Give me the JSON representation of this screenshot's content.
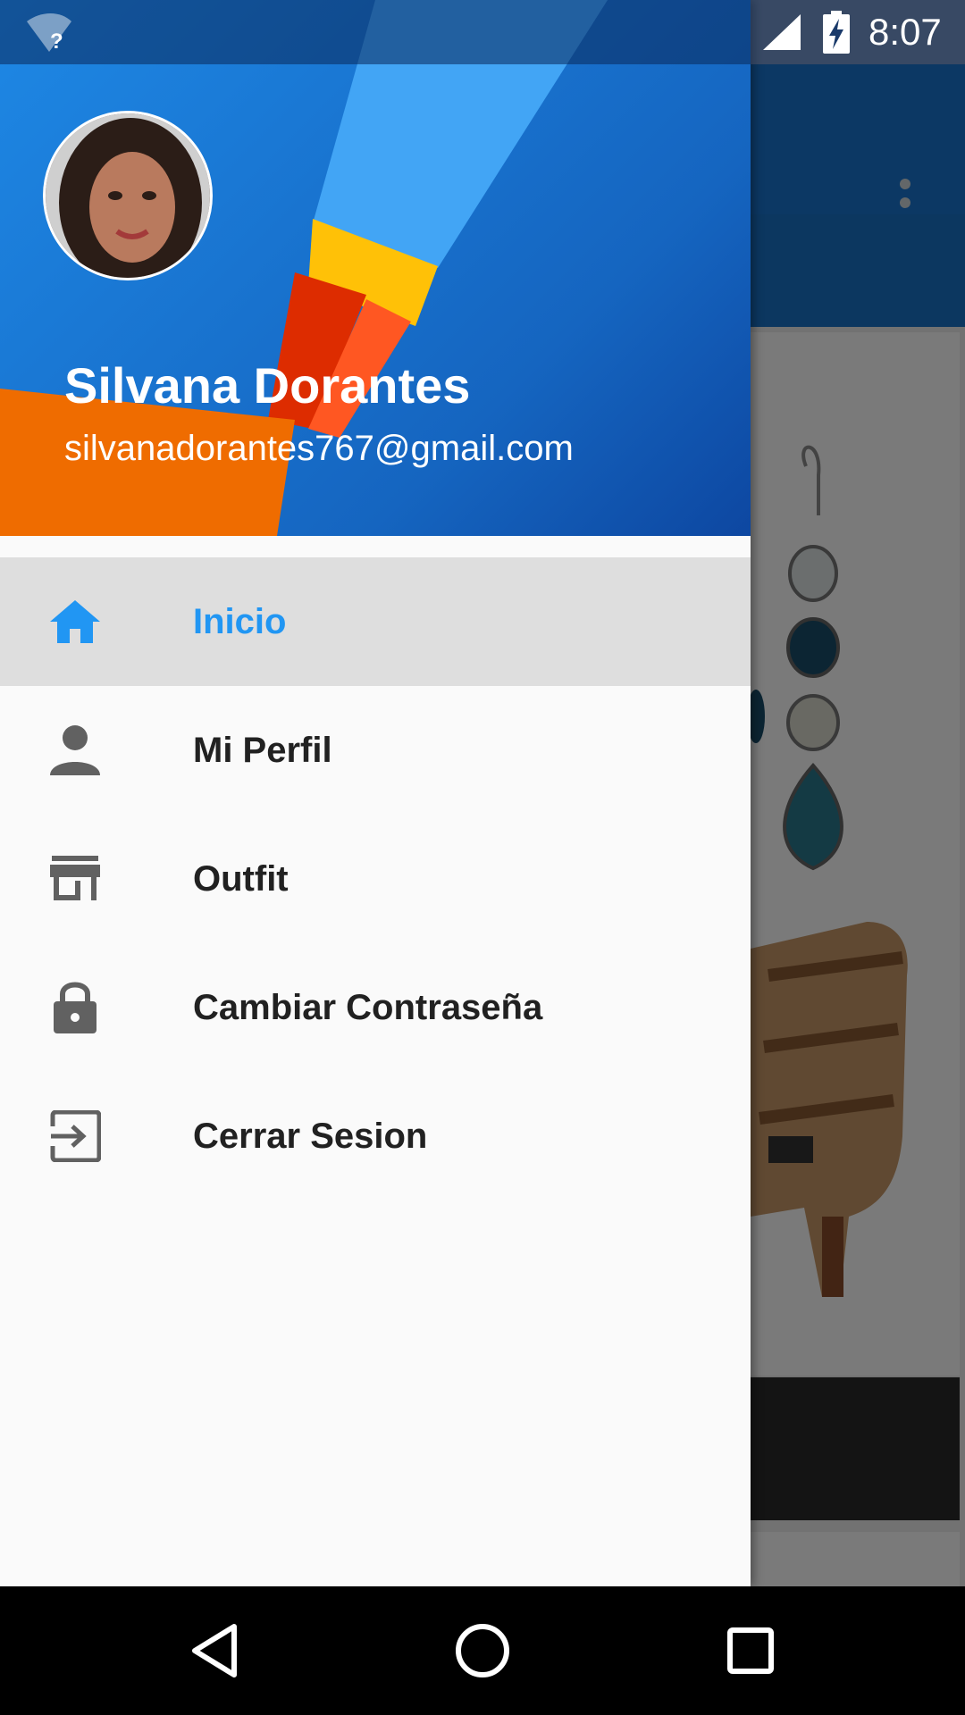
{
  "status_bar": {
    "time": "8:07",
    "wifi_icon": "wifi-unknown-icon",
    "signal_icon": "cell-signal-icon",
    "battery_icon": "battery-charging-icon"
  },
  "drawer": {
    "header": {
      "user_name": "Silvana Dorantes",
      "user_email": "silvanadorantes767@gmail.com"
    },
    "items": [
      {
        "label": "Inicio",
        "icon": "home-icon",
        "selected": true
      },
      {
        "label": "Mi Perfil",
        "icon": "person-icon",
        "selected": false
      },
      {
        "label": "Outfit",
        "icon": "store-icon",
        "selected": false
      },
      {
        "label": "Cambiar Contraseña",
        "icon": "lock-icon",
        "selected": false
      },
      {
        "label": "Cerrar Sesion",
        "icon": "exit-icon",
        "selected": false
      }
    ]
  },
  "background_app": {
    "overflow_icon": "more-vert-icon"
  },
  "nav_bar": {
    "back_icon": "back-icon",
    "home_icon": "home-circle-icon",
    "recents_icon": "recents-icon"
  },
  "colors": {
    "primary": "#1976d2",
    "accent_selected": "#2196f3",
    "header_orange": "#ef6c00",
    "header_yellow": "#ffc107",
    "header_red": "#dd2c00"
  }
}
